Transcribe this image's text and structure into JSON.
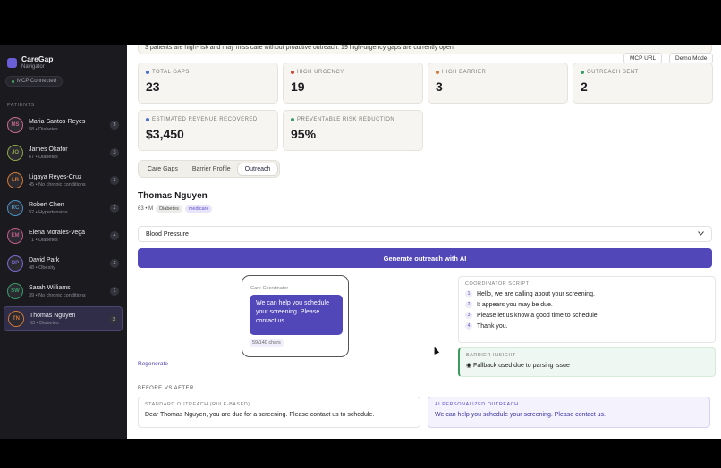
{
  "brand": {
    "name": "CareGap",
    "subtitle": "Navigator",
    "status": "MCP Connected"
  },
  "sidebar": {
    "section_label": "PATIENTS",
    "patients": [
      {
        "initials": "MS",
        "name": "Maria Santos-Reyes",
        "meta": "58 • Diabetes",
        "count": "5",
        "color": "#c86a8c"
      },
      {
        "initials": "JO",
        "name": "James Okafor",
        "meta": "67 • Diabetes",
        "count": "3",
        "color": "#8ca84a"
      },
      {
        "initials": "LR",
        "name": "Ligaya Reyes-Cruz",
        "meta": "45 • No chronic conditions",
        "count": "3",
        "color": "#d07a3a"
      },
      {
        "initials": "RC",
        "name": "Robert Chen",
        "meta": "52 • Hypertension",
        "count": "2",
        "color": "#4a8ec2"
      },
      {
        "initials": "EM",
        "name": "Elena Morales-Vega",
        "meta": "71 • Diabetes",
        "count": "4",
        "color": "#c25a8a"
      },
      {
        "initials": "DP",
        "name": "David Park",
        "meta": "48 • Obesity",
        "count": "2",
        "color": "#7a6ad0"
      },
      {
        "initials": "SW",
        "name": "Sarah Williams",
        "meta": "39 • No chronic conditions",
        "count": "1",
        "color": "#3a9a6a"
      },
      {
        "initials": "TN",
        "name": "Thomas Nguyen",
        "meta": "63 • Diabetes",
        "count": "3",
        "color": "#d0763a"
      }
    ]
  },
  "banner": {
    "text": "3 patients are high-risk and may miss care without proactive outreach. 19 high-urgency gaps are currently open."
  },
  "header": {
    "mcp_url_label": "MCP URL",
    "demo_mode_label": "Demo Mode"
  },
  "stats": [
    {
      "label": "TOTAL GAPS",
      "value": "23",
      "color": "#4a6ad0"
    },
    {
      "label": "HIGH URGENCY",
      "value": "19",
      "color": "#d0463a"
    },
    {
      "label": "HIGH BARRIER",
      "value": "3",
      "color": "#d07a3a"
    },
    {
      "label": "OUTREACH SENT",
      "value": "2",
      "color": "#3a9a6a"
    },
    {
      "label": "ESTIMATED REVENUE RECOVERED",
      "value": "$3,450",
      "color": "#4a6ad0"
    },
    {
      "label": "PREVENTABLE RISK REDUCTION",
      "value": "95%",
      "color": "#3a9a6a"
    }
  ],
  "tabs": [
    {
      "label": "Care Gaps"
    },
    {
      "label": "Barrier Profile"
    },
    {
      "label": "Outreach"
    }
  ],
  "patient": {
    "name": "Thomas Nguyen",
    "age_sex": "63 • M",
    "chip1": "Diabetes",
    "chip2": "medicare"
  },
  "outreach": {
    "measure_select": "Blood Pressure",
    "generate_label": "Generate outreach with AI",
    "phone_title": "Care Coordinator",
    "message": "We can help you schedule your screening. Please contact us.",
    "char_count": "59/140 chars",
    "regenerate_label": "Regenerate",
    "script_label": "COORDINATOR SCRIPT",
    "script": [
      {
        "n": "1",
        "text": "Hello, we are calling about your screening."
      },
      {
        "n": "2",
        "text": "It appears you may be due."
      },
      {
        "n": "3",
        "text": "Please let us know a good time to schedule."
      },
      {
        "n": "4",
        "text": "Thank you."
      }
    ],
    "insight_label": "BARRIER INSIGHT",
    "insight_text": "◉ Fallback used due to parsing issue",
    "bva_label": "BEFORE VS AFTER",
    "standard_label": "STANDARD OUTREACH (RULE-BASED)",
    "standard_text": "Dear Thomas Nguyen, you are due for a screening. Please contact us to schedule.",
    "ai_label": "AI PERSONALIZED OUTREACH",
    "ai_text": "We can help you schedule your screening. Please contact us."
  }
}
